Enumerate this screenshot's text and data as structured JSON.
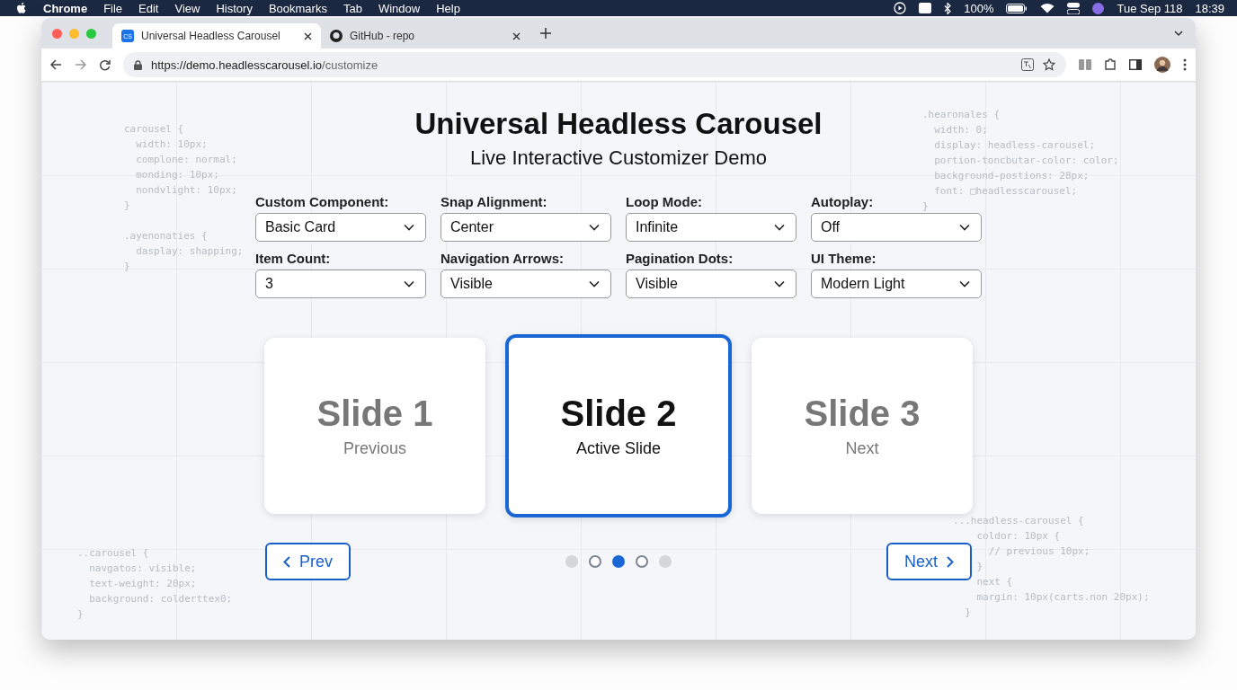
{
  "menu_bar": {
    "app": "Chrome",
    "items": [
      "File",
      "Edit",
      "View",
      "History",
      "Bookmarks",
      "Tab",
      "Window",
      "Help"
    ],
    "battery": "100%",
    "date": "Tue Sep 118",
    "time": "18:39"
  },
  "tabs": [
    {
      "favicon": "CS",
      "title": "Universal Headless Carousel",
      "selected": true
    },
    {
      "title": "GitHub - repo",
      "selected": false
    }
  ],
  "address_bar": {
    "host": "https://demo.headlesscarousel.io",
    "path": "/customize"
  },
  "page": {
    "title": "Universal Headless Carousel",
    "subtitle": "Live Interactive Customizer Demo",
    "controls": [
      {
        "label": "Custom Component:",
        "value": "Basic Card"
      },
      {
        "label": "Snap Alignment:",
        "value": "Center"
      },
      {
        "label": "Loop Mode:",
        "value": "Infinite"
      },
      {
        "label": "Autoplay:",
        "value": "Off"
      },
      {
        "label": "Item Count:",
        "value": "3"
      },
      {
        "label": "Navigation Arrows:",
        "value": "Visible"
      },
      {
        "label": "Pagination Dots:",
        "value": "Visible"
      },
      {
        "label": "UI Theme:",
        "value": "Modern Light"
      }
    ],
    "slides": [
      {
        "title": "Slide 1",
        "caption": "Previous",
        "selected": false
      },
      {
        "title": "Slide 2",
        "caption": "Active Slide",
        "selected": true
      },
      {
        "title": "Slide 3",
        "caption": "Next",
        "selected": false
      }
    ],
    "prev_button": "Prev",
    "next_button": "Next",
    "dots": [
      {
        "kind": "filled",
        "selected": false
      },
      {
        "kind": "outline",
        "selected": false
      },
      {
        "kind": "filled",
        "selected": true
      },
      {
        "kind": "outline",
        "selected": false
      },
      {
        "kind": "filled",
        "selected": false
      }
    ],
    "code_snippets": [
      {
        "lines": [
          "carousel {",
          "  width: 10px;",
          "  complone: normal;",
          "  monding: 10px;",
          "  nondvlight: 10px;",
          "}"
        ]
      },
      {
        "lines": [
          ".ayenonaties {",
          "  dasplay: shapping;",
          "}"
        ]
      },
      {
        "lines": [
          ".hearonales {",
          "  width: 0;",
          "  display: headless-carousel;",
          "  portion-toncbutar-color: color;",
          "  background-postions: 28px;",
          "  font: □headlesscarousel;",
          "}"
        ]
      },
      {
        "lines": [
          "..carousel {",
          "  navgatos: visible;",
          "  text-weight: 20px;",
          "  background: colderttex0;",
          "}"
        ]
      },
      {
        "lines": [
          "...headless-carousel {",
          "    coldor: 10px {",
          "      // previous 10px;",
          "    }",
          "    next {",
          "    margin: 10px(carts.non 20px);",
          "  }"
        ]
      }
    ]
  }
}
